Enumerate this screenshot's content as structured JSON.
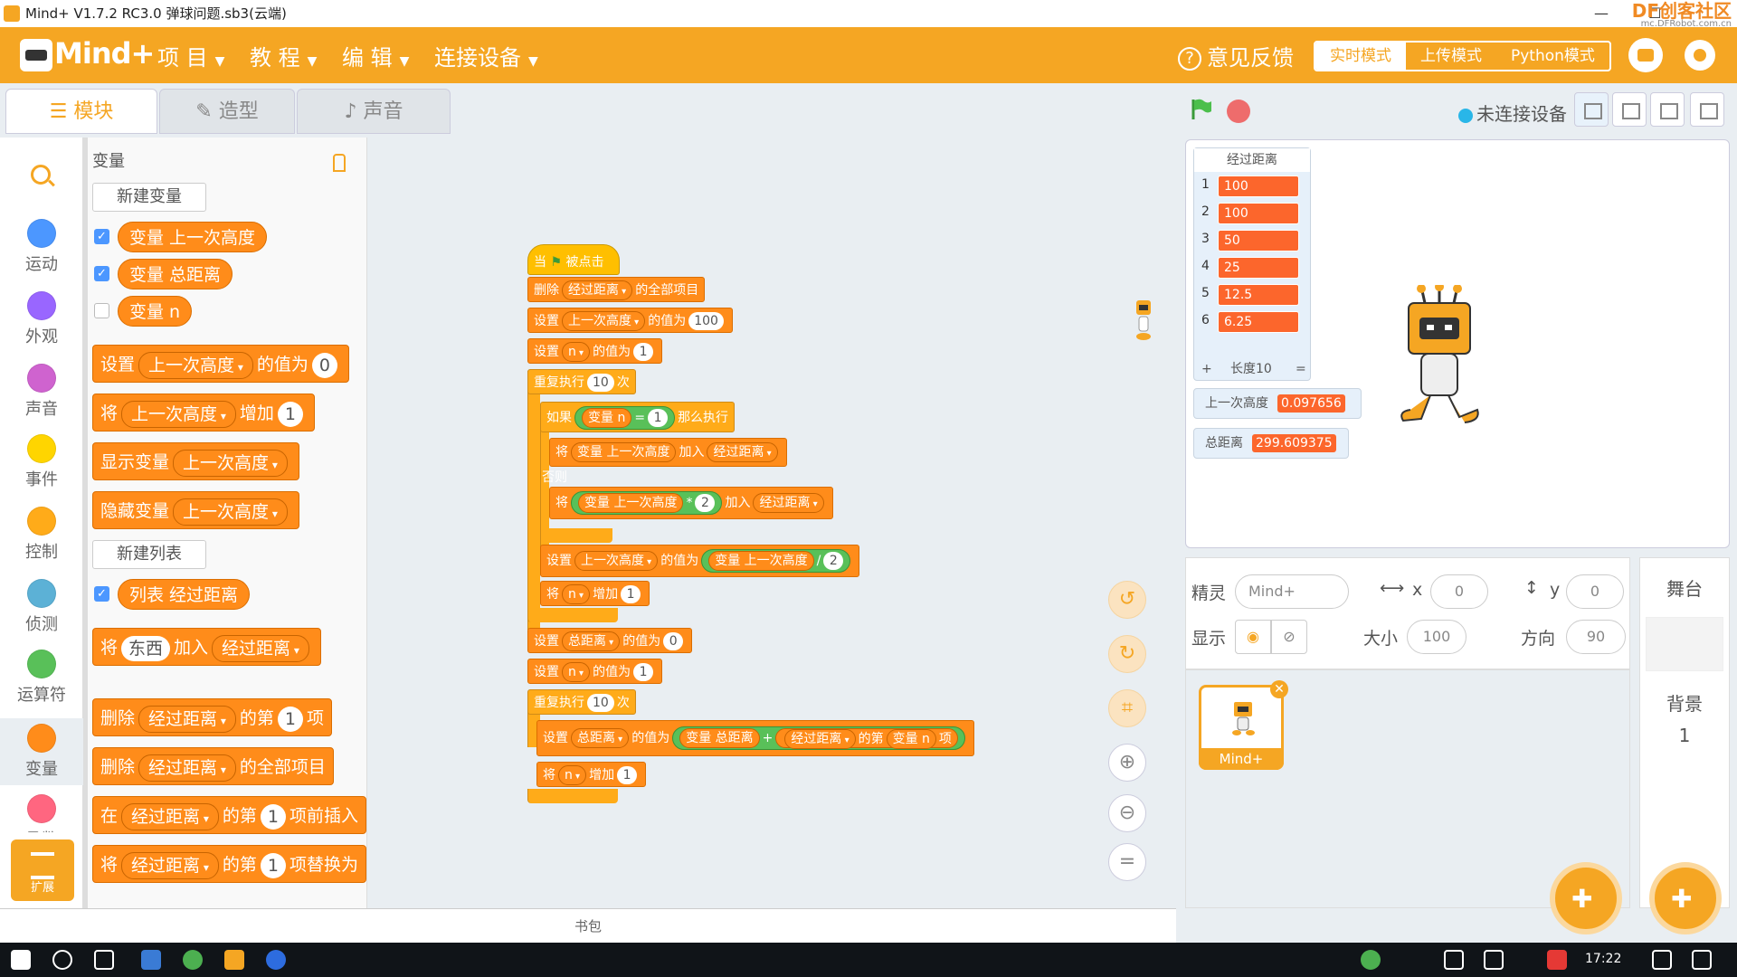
{
  "window": {
    "title": "Mind+ V1.7.2 RC3.0   弹球问题.sb3(云端)",
    "minimize": "—",
    "maximize": "☐",
    "dfrobot_brand": "DF创客社区",
    "dfrobot_url": "mc.DFRobot.com.cn"
  },
  "menubar": {
    "logo": "Mind+",
    "items": [
      "项 目",
      "教 程",
      "编 辑",
      "连接设备"
    ],
    "feedback": "意见反馈",
    "modes": [
      "实时模式",
      "上传模式",
      "Python模式"
    ]
  },
  "tabs": [
    "模块",
    "造型",
    "声音"
  ],
  "stage_controls": {
    "conn_status": "未连接设备"
  },
  "categories": [
    "运动",
    "外观",
    "声音",
    "事件",
    "控制",
    "侦测",
    "运算符",
    "变量",
    "函数"
  ],
  "extension_label": "扩展",
  "palette": {
    "title": "变量",
    "new_var": "新建变量",
    "vars": [
      "变量 上一次高度",
      "变量 总距离",
      "变量 n"
    ],
    "set": {
      "prefix": "设置",
      "var": "上一次高度",
      "mid": "的值为",
      "value": "0"
    },
    "change": {
      "prefix": "将",
      "var": "上一次高度",
      "mid": "增加",
      "value": "1"
    },
    "show": {
      "prefix": "显示变量",
      "var": "上一次高度"
    },
    "hide": {
      "prefix": "隐藏变量",
      "var": "上一次高度"
    },
    "new_list": "新建列表",
    "list": "列表 经过距离",
    "add": {
      "p1": "将",
      "thing": "东西",
      "p2": "加入",
      "list": "经过距离"
    },
    "del_n": {
      "p1": "删除",
      "list": "经过距离",
      "p2": "的第",
      "n": "1",
      "p3": "项"
    },
    "del_all": {
      "p1": "删除",
      "list": "经过距离",
      "p2": "的全部项目"
    },
    "insert": {
      "p1": "在",
      "list": "经过距离",
      "p2": "的第",
      "n": "1",
      "p3": "项前插入"
    },
    "replace": {
      "p1": "将",
      "list": "经过距离",
      "p2": "的第",
      "n": "1",
      "p3": "项替换为"
    }
  },
  "script": {
    "when_flag": {
      "p1": "当",
      "p2": "被点击"
    },
    "del_all": {
      "p1": "删除",
      "list": "经过距离",
      "p2": "的全部项目"
    },
    "set1": {
      "p1": "设置",
      "var": "上一次高度",
      "p2": "的值为",
      "v": "100"
    },
    "set2": {
      "p1": "设置",
      "var": "n",
      "p2": "的值为",
      "v": "1"
    },
    "repeat1": {
      "p1": "重复执行",
      "v": "10",
      "p2": "次"
    },
    "if": {
      "p1": "如果",
      "var": "变量 n",
      "op": "=",
      "v": "1",
      "p2": "那么执行"
    },
    "add1": {
      "p1": "将",
      "var": "变量 上一次高度",
      "p2": "加入",
      "list": "经过距离"
    },
    "else": "否则",
    "add2": {
      "p1": "将",
      "var": "变量 上一次高度",
      "op": "*",
      "v": "2",
      "p2": "加入",
      "list": "经过距离"
    },
    "set3": {
      "p1": "设置",
      "var": "上一次高度",
      "p2": "的值为",
      "var2": "变量 上一次高度",
      "op": "/",
      "v": "2"
    },
    "change1": {
      "p1": "将",
      "var": "n",
      "p2": "增加",
      "v": "1"
    },
    "set4": {
      "p1": "设置",
      "var": "总距离",
      "p2": "的值为",
      "v": "0"
    },
    "set5": {
      "p1": "设置",
      "var": "n",
      "p2": "的值为",
      "v": "1"
    },
    "repeat2": {
      "p1": "重复执行",
      "v": "10",
      "p2": "次"
    },
    "set6": {
      "p1": "设置",
      "var": "总距离",
      "p2": "的值为",
      "var2": "变量 总距离",
      "op": "+",
      "list": "经过距离",
      "p3": "的第",
      "var3": "变量 n",
      "p4": "项"
    },
    "change2": {
      "p1": "将",
      "var": "n",
      "p2": "增加",
      "v": "1"
    }
  },
  "backpack": "书包",
  "stage": {
    "list_monitor": {
      "title": "经过距离",
      "items": [
        "100",
        "100",
        "50",
        "25",
        "12.5",
        "6.25"
      ],
      "footer_plus": "+",
      "length": "长度10",
      "footer_eq": "="
    },
    "var_monitors": [
      {
        "label": "上一次高度",
        "value": "0.097656"
      },
      {
        "label": "总距离",
        "value": "299.609375"
      }
    ]
  },
  "sprite_info": {
    "sprite_label": "精灵",
    "sprite_name": "Mind+",
    "x_label": "x",
    "x": "0",
    "y_label": "y",
    "y": "0",
    "show_label": "显示",
    "size_label": "大小",
    "size": "100",
    "dir_label": "方向",
    "dir": "90"
  },
  "sprite_list": [
    {
      "name": "Mind+"
    }
  ],
  "stage_panel": {
    "title": "舞台",
    "bg_label": "背景",
    "bg_count": "1"
  },
  "taskbar": {
    "time": "17:22"
  }
}
